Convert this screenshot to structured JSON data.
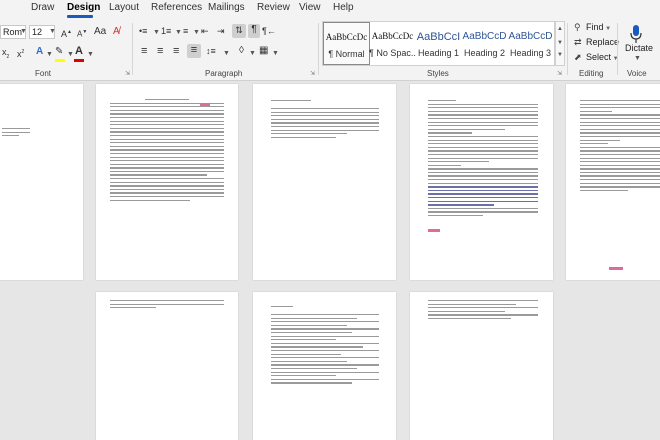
{
  "tabs": [
    "Draw",
    "Design",
    "Layout",
    "References",
    "Mailings",
    "Review",
    "View",
    "Help"
  ],
  "active_tab": "Design",
  "font": {
    "name": "Rom",
    "size": "12",
    "group_label": "Font"
  },
  "paragraph": {
    "group_label": "Paragraph"
  },
  "styles": {
    "group_label": "Styles",
    "items": [
      {
        "preview": "AaBbCcDc",
        "name": "¶ Normal"
      },
      {
        "preview": "AaBbCcDc",
        "name": "¶ No Spac..."
      },
      {
        "preview": "AaBbCcI",
        "name": "Heading 1"
      },
      {
        "preview": "AaBbCcD",
        "name": "Heading 2"
      },
      {
        "preview": "AaBbCcD",
        "name": "Heading 3"
      }
    ]
  },
  "editing": {
    "group_label": "Editing",
    "find": "Find",
    "replace": "Replace",
    "select": "Select"
  },
  "voice": {
    "group_label": "Voice",
    "dictate": "Dictate"
  },
  "colors": {
    "accent": "#185abd",
    "highlight": "#ffff00",
    "font_color": "#e00000",
    "heading": "#2f5496"
  },
  "icons": {
    "find": "search-icon",
    "replace": "replace-icon",
    "select": "select-arrow-icon",
    "dictate": "microphone-icon"
  }
}
